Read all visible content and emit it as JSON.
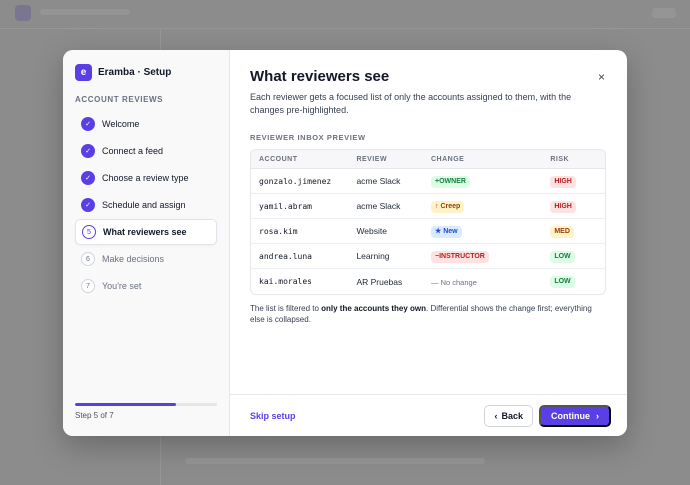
{
  "modal": {
    "brand": {
      "mark": "e",
      "name": "Eramba · Setup"
    },
    "side_section": "ACCOUNT REVIEWS",
    "steps": [
      {
        "num": "✓",
        "label": "Welcome",
        "state": "done"
      },
      {
        "num": "✓",
        "label": "Connect a feed",
        "state": "done"
      },
      {
        "num": "✓",
        "label": "Choose a review type",
        "state": "done"
      },
      {
        "num": "✓",
        "label": "Schedule and assign",
        "state": "done"
      },
      {
        "num": "5",
        "label": "What reviewers see",
        "state": "current"
      },
      {
        "num": "6",
        "label": "Make decisions",
        "state": "todo"
      },
      {
        "num": "7",
        "label": "You're set",
        "state": "todo"
      }
    ],
    "progress_fraction": 0.714,
    "step_count": "Step 5 of 7",
    "title": "What reviewers see",
    "subtitle": "Each reviewer gets a focused list of only the accounts assigned to them, with the changes pre-highlighted.",
    "close_glyph": "×",
    "preview_label": "REVIEWER INBOX PREVIEW",
    "table": {
      "headers": [
        "ACCOUNT",
        "REVIEW",
        "CHANGE",
        "RISK"
      ],
      "rows": [
        {
          "account": "gonzalo.jimenez",
          "review": "acme Slack",
          "change": "+OWNER",
          "change_style": "green",
          "risk": "HIGH",
          "risk_style": "high"
        },
        {
          "account": "yamil.abram",
          "review": "acme Slack",
          "change": "↑ Creep",
          "change_style": "yellow",
          "risk": "HIGH",
          "risk_style": "high"
        },
        {
          "account": "rosa.kim",
          "review": "Website",
          "change": "★ New",
          "change_style": "blue",
          "risk": "MED",
          "risk_style": "med"
        },
        {
          "account": "andrea.luna",
          "review": "Learning",
          "change": "−INSTRUCTOR",
          "change_style": "red",
          "risk": "LOW",
          "risk_style": "low"
        },
        {
          "account": "kai.morales",
          "review": "AR Pruebas",
          "change": "— No change",
          "change_style": "none",
          "risk": "LOW",
          "risk_style": "low"
        }
      ]
    },
    "note": {
      "before": "The list is filtered to ",
      "bold": "only the accounts they own",
      "after": ". Differential shows the change first; everything else is collapsed."
    },
    "footer": {
      "skip_label": "Skip setup",
      "back_label": "Back",
      "back_icon": "‹",
      "continue_label": "Continue",
      "continue_icon": "›"
    }
  },
  "colors": {
    "accent": "#5b3fe6"
  }
}
